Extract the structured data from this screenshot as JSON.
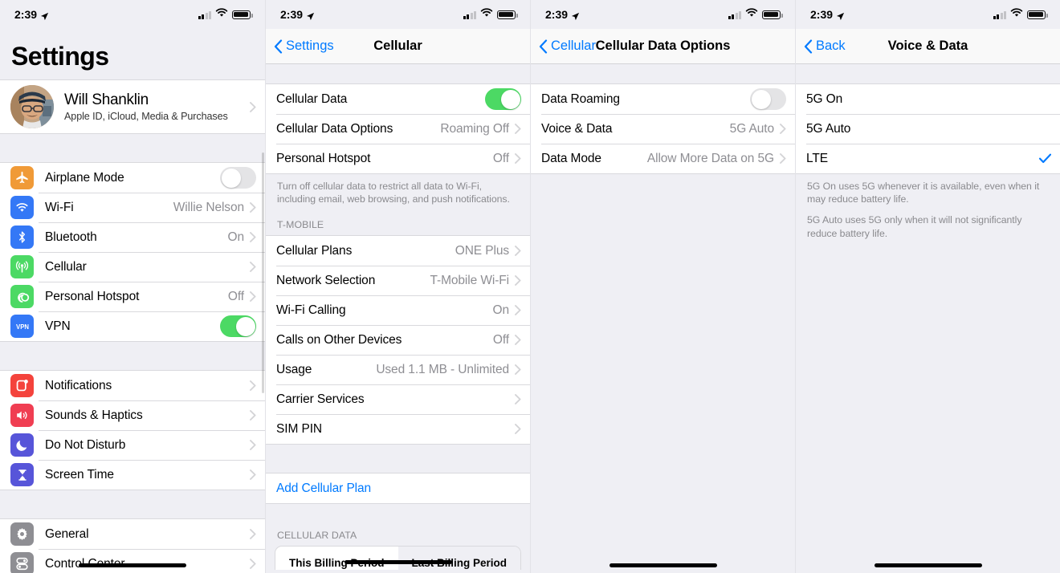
{
  "status_bar": {
    "time": "2:39",
    "location_icon": "location-arrow-icon",
    "signal_icon": "cellular-bars-icon",
    "wifi_icon": "wifi-icon",
    "battery_icon": "battery-icon"
  },
  "colors": {
    "accent_blue": "#007aff",
    "toggle_on_green": "#4cd964",
    "secondary_text": "#8e8e93",
    "group_bg": "#efeff4"
  },
  "panel1": {
    "title": "Settings",
    "account": {
      "name": "Will Shanklin",
      "subtitle": "Apple ID, iCloud, Media & Purchases",
      "avatar": "user-photo-avatar"
    },
    "group1": [
      {
        "label": "Airplane Mode",
        "icon": "airplane-icon",
        "icon_color": "#f09a37",
        "control": "toggle",
        "on": false
      },
      {
        "label": "Wi-Fi",
        "icon": "wifi-icon",
        "icon_color": "#3478f6",
        "control": "disclosure",
        "value": "Willie Nelson"
      },
      {
        "label": "Bluetooth",
        "icon": "bluetooth-icon",
        "icon_color": "#3478f6",
        "control": "disclosure",
        "value": "On"
      },
      {
        "label": "Cellular",
        "icon": "cellular-antenna-icon",
        "icon_color": "#4cd964",
        "control": "disclosure",
        "value": ""
      },
      {
        "label": "Personal Hotspot",
        "icon": "hotspot-icon",
        "icon_color": "#4cd964",
        "control": "disclosure",
        "value": "Off"
      },
      {
        "label": "VPN",
        "icon": "vpn-icon",
        "icon_color": "#3478f6",
        "control": "toggle",
        "on": true
      }
    ],
    "group2": [
      {
        "label": "Notifications",
        "icon": "notifications-icon",
        "icon_color": "#f4433c",
        "control": "disclosure",
        "value": ""
      },
      {
        "label": "Sounds & Haptics",
        "icon": "speaker-icon",
        "icon_color": "#f03e52",
        "control": "disclosure",
        "value": ""
      },
      {
        "label": "Do Not Disturb",
        "icon": "moon-icon",
        "icon_color": "#5755d9",
        "control": "disclosure",
        "value": ""
      },
      {
        "label": "Screen Time",
        "icon": "hourglass-icon",
        "icon_color": "#5755d9",
        "control": "disclosure",
        "value": ""
      }
    ],
    "group3": [
      {
        "label": "General",
        "icon": "gear-icon",
        "icon_color": "#8e8e93",
        "control": "disclosure",
        "value": ""
      },
      {
        "label": "Control Center",
        "icon": "control-center-icon",
        "icon_color": "#8e8e93",
        "control": "disclosure",
        "value": ""
      }
    ]
  },
  "panel2": {
    "nav": {
      "back_label": "Settings",
      "title": "Cellular"
    },
    "group1": [
      {
        "label": "Cellular Data",
        "control": "toggle",
        "on": true,
        "value": ""
      },
      {
        "label": "Cellular Data Options",
        "control": "disclosure",
        "value": "Roaming Off"
      },
      {
        "label": "Personal Hotspot",
        "control": "disclosure",
        "value": "Off"
      }
    ],
    "footnote": "Turn off cellular data to restrict all data to Wi-Fi, including email, web browsing, and push notifications.",
    "group2_header": "T-MOBILE",
    "group2": [
      {
        "label": "Cellular Plans",
        "control": "disclosure",
        "value": "ONE Plus"
      },
      {
        "label": "Network Selection",
        "control": "disclosure",
        "value": "T-Mobile Wi-Fi"
      },
      {
        "label": "Wi-Fi Calling",
        "control": "disclosure",
        "value": "On"
      },
      {
        "label": "Calls on Other Devices",
        "control": "disclosure",
        "value": "Off"
      },
      {
        "label": "Usage",
        "control": "disclosure",
        "value": "Used 1.1 MB - Unlimited"
      },
      {
        "label": "Carrier Services",
        "control": "disclosure",
        "value": ""
      },
      {
        "label": "SIM PIN",
        "control": "disclosure",
        "value": ""
      }
    ],
    "group3": [
      {
        "label": "Add Cellular Plan",
        "control": "none",
        "value": ""
      }
    ],
    "group4_header": "CELLULAR DATA",
    "segmented": {
      "options": [
        "This Billing Period",
        "Last Billing Period"
      ],
      "selected": "This Billing Period"
    }
  },
  "panel3": {
    "nav": {
      "back_label": "Cellular",
      "title": "Cellular Data Options"
    },
    "group1": [
      {
        "label": "Data Roaming",
        "control": "toggle",
        "on": false,
        "value": ""
      },
      {
        "label": "Voice & Data",
        "control": "disclosure",
        "value": "5G Auto"
      },
      {
        "label": "Data Mode",
        "control": "disclosure",
        "value": "Allow More Data on 5G"
      }
    ]
  },
  "panel4": {
    "nav": {
      "back_label": "Back",
      "title": "Voice & Data"
    },
    "options": [
      {
        "label": "5G On",
        "selected": false
      },
      {
        "label": "5G Auto",
        "selected": false
      },
      {
        "label": "LTE",
        "selected": true
      }
    ],
    "footnotes": [
      "5G On uses 5G whenever it is available, even when it may reduce battery life.",
      "5G Auto uses 5G only when it will not significantly reduce battery life."
    ]
  }
}
